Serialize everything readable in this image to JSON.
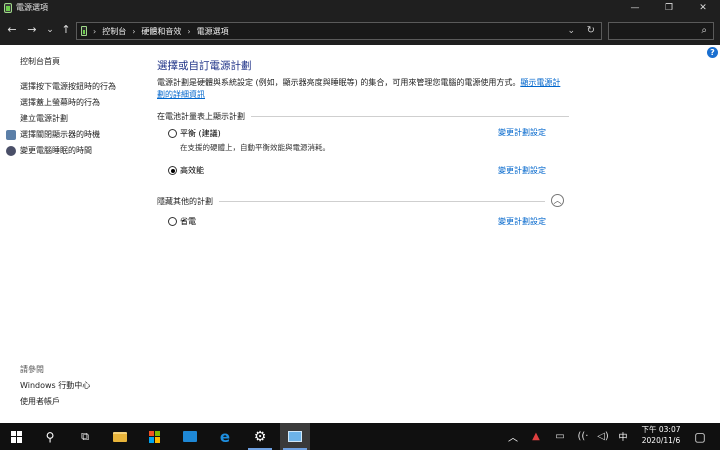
{
  "window": {
    "title": "電源選項"
  },
  "window_controls": {
    "minimize": "—",
    "maximize": "❐",
    "close": "✕"
  },
  "nav": {
    "back": "←",
    "forward": "→",
    "recent": "⌄",
    "up": "↑",
    "breadcrumb": [
      "控制台",
      "硬體和音效",
      "電源選項"
    ],
    "separator": "›",
    "address_dropdown": "⌄",
    "refresh": "↻",
    "search_placeholder": "",
    "search_icon": "⌕"
  },
  "help": {
    "label": "?"
  },
  "sidebar": {
    "top_link": "控制台首頁",
    "items": [
      {
        "label": "選擇按下電源按鈕時的行為"
      },
      {
        "label": "選擇蓋上螢幕時的行為"
      },
      {
        "label": "建立電源計劃"
      },
      {
        "label": "選擇關閉顯示器的時機",
        "icon": "monitor-icon"
      },
      {
        "label": "變更電腦睡眠的時間",
        "icon": "sleep-moon-icon"
      }
    ],
    "see_also_title": "請參閱",
    "see_also": [
      {
        "label": "Windows 行動中心"
      },
      {
        "label": "使用者帳戶"
      }
    ]
  },
  "main": {
    "title": "選擇或自訂電源計劃",
    "description": "電源計劃是硬體與系統設定 (例如，顯示器亮度與睡眠等) 的集合，可用來管理您電腦的電源使用方式。",
    "description_link": "顯示電源計劃的詳細資訊",
    "battery_meter_heading": "在電池計量表上顯示計劃",
    "hidden_heading": "隱藏其他的計劃",
    "collapse_glyph": "︿",
    "change_label": "變更計劃設定",
    "plans": [
      {
        "name": "平衡 (建議)",
        "desc": "在支援的硬體上，自動平衡效能與電源消耗。",
        "selected": false
      },
      {
        "name": "高效能",
        "desc": "",
        "selected": true
      },
      {
        "name": "省電",
        "desc": "",
        "selected": false
      }
    ]
  },
  "taskbar": {
    "search_icon": "⚲",
    "taskview_icon": "⧉",
    "tray": {
      "chevron": "︿",
      "ime": "中"
    },
    "clock": {
      "time": "下午 03:07",
      "date": "2020/11/6"
    }
  },
  "colors": {
    "title_blue": "#1e3287",
    "link_blue": "#0066cc",
    "chrome_dark": "#1f1f1f",
    "taskbar": "#101010",
    "help_blue": "#1a6fd0"
  }
}
